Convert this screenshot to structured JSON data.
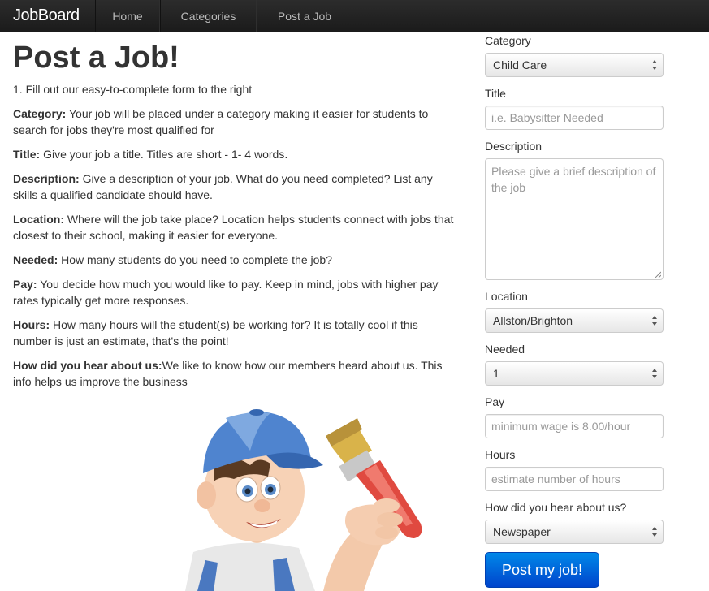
{
  "navbar": {
    "brand": "JobBoard",
    "items": [
      "Home",
      "Categories",
      "Post a Job"
    ]
  },
  "page": {
    "title": "Post a Job!",
    "intro": "1. Fill out our easy-to-complete form to the right",
    "instructions": [
      {
        "term": "Category:",
        "text": " Your job will be placed under a category making it easier for students to search for jobs they're most qualified for"
      },
      {
        "term": "Title:",
        "text": " Give your job a title. Titles are short - 1- 4 words."
      },
      {
        "term": "Description:",
        "text": " Give a description of your job. What do you need completed? List any skills a qualified candidate should have."
      },
      {
        "term": "Location:",
        "text": " Where will the job take place? Location helps students connect with jobs that closest to their school, making it easier for everyone."
      },
      {
        "term": "Needed:",
        "text": " How many students do you need to complete the job?"
      },
      {
        "term": "Pay:",
        "text": " You decide how much you would like to pay. Keep in mind, jobs with higher pay rates typically get more responses."
      },
      {
        "term": "Hours:",
        "text": " How many hours will the student(s) be working for? It is totally cool if this number is just an estimate, that's the point!"
      },
      {
        "term": "How did you hear about us:",
        "text": "We like to know how our members heard about us. This info helps us improve the business"
      }
    ]
  },
  "form": {
    "category": {
      "label": "Category",
      "value": "Child Care"
    },
    "title": {
      "label": "Title",
      "placeholder": "i.e. Babysitter Needed"
    },
    "description": {
      "label": "Description",
      "placeholder": "Please give a brief description of the job"
    },
    "location": {
      "label": "Location",
      "value": "Allston/Brighton"
    },
    "needed": {
      "label": "Needed",
      "value": "1"
    },
    "pay": {
      "label": "Pay",
      "placeholder": "minimum wage is 8.00/hour"
    },
    "hours": {
      "label": "Hours",
      "placeholder": "estimate number of hours"
    },
    "referral": {
      "label": "How did you hear about us?",
      "value": "Newspaper"
    },
    "submit_label": "Post my job!"
  },
  "colors": {
    "navbar": "#1b1b1b",
    "button": "#0066dd"
  }
}
